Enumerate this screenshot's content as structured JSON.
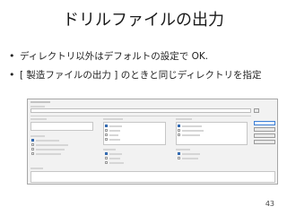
{
  "slide": {
    "title": "ドリルファイルの出力",
    "bullets": [
      "ディレクトリ以外はデフォルトの設定で OK.",
      "[ 製造ファイルの出力 ] のときと同じディレクトリを指定"
    ],
    "page_number": "43"
  }
}
